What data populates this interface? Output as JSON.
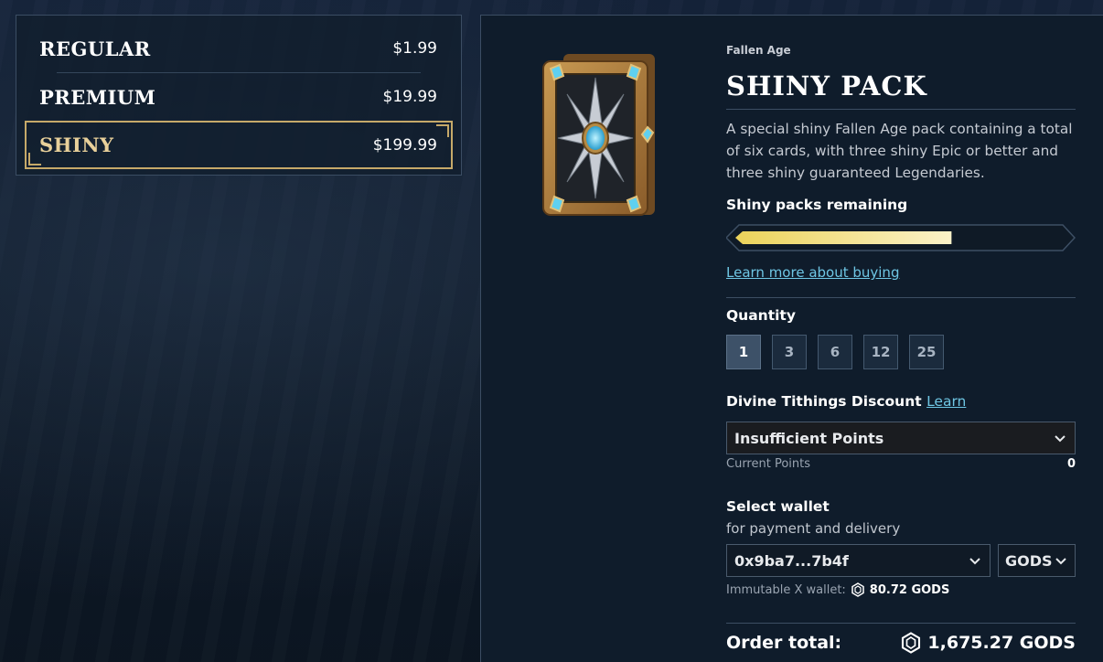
{
  "packs": [
    {
      "name": "REGULAR",
      "price": "$1.99"
    },
    {
      "name": "PREMIUM",
      "price": "$19.99"
    },
    {
      "name": "SHINY",
      "price": "$199.99"
    }
  ],
  "selected_pack": "SHINY",
  "detail": {
    "game": "Fallen Age",
    "title": "SHINY PACK",
    "description": "A special shiny Fallen Age pack containing a total of six cards, with three shiny Epic or better and three shiny guaranteed Legendaries.",
    "remaining_label": "Shiny packs remaining",
    "remaining_fraction": 0.66,
    "learn_more": "Learn more about buying"
  },
  "quantity": {
    "label": "Quantity",
    "options": [
      "1",
      "3",
      "6",
      "12",
      "25"
    ],
    "selected": "1"
  },
  "discount": {
    "label": "Divine Tithings Discount",
    "learn": "Learn",
    "value": "Insufficient Points",
    "points_label": "Current Points",
    "points_value": "0"
  },
  "wallet": {
    "label": "Select wallet",
    "sub": "for payment and delivery",
    "address": "0x9ba7...7b4f",
    "currency": "GODS",
    "imx_label": "Immutable X wallet:",
    "imx_balance": "80.72 GODS"
  },
  "order": {
    "label": "Order total:",
    "value": "1,675.27 GODS"
  },
  "colors": {
    "gold": "#c6a969",
    "link": "#6ec6e4",
    "progress_fill": "#f0dd7a"
  }
}
